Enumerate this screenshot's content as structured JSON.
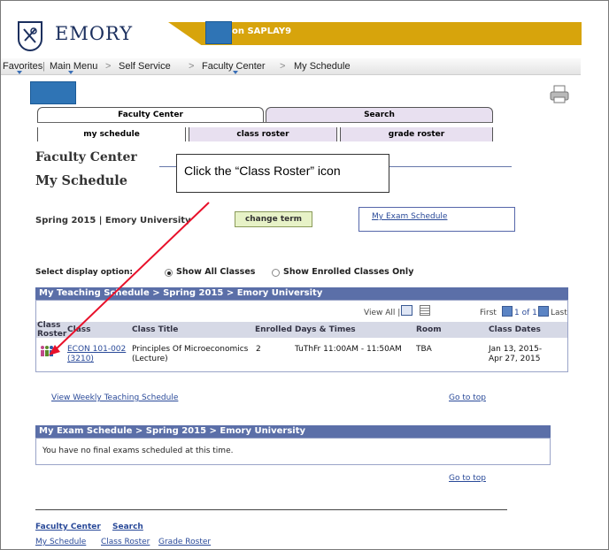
{
  "header": {
    "logo_text": "EMORY",
    "environment": "on SAPLAY9",
    "colors": {
      "navy": "#1b2f5e",
      "gold": "#d7a40c",
      "redaction_blue": "#2f74b5"
    }
  },
  "menu": {
    "favorites": "Favorites",
    "main_menu": "Main Menu",
    "sep": ">",
    "self_service": "Self Service",
    "faculty_center": "Faculty Center",
    "my_schedule": "My Schedule"
  },
  "tabs": {
    "faculty_center": "Faculty Center",
    "search": "Search"
  },
  "subtabs": {
    "my_schedule": "my schedule",
    "class_roster": "class roster",
    "grade_roster": "grade roster"
  },
  "page": {
    "section_title": "Faculty Center",
    "page_title": "My Schedule",
    "term": "Spring 2015 | Emory University",
    "change_term": "change term",
    "exam_schedule_link": "My Exam Schedule"
  },
  "callout": {
    "text": "Click the “Class Roster” icon"
  },
  "display_options": {
    "label": "Select display option:",
    "all_classes": "Show All Classes",
    "enrolled_only": "Show Enrolled Classes Only",
    "selected": "all"
  },
  "teaching_grid": {
    "title": "My Teaching Schedule > Spring 2015 > Emory University",
    "view_all": "View All |",
    "first": "First",
    "pagination": "1 of 1",
    "last": "Last",
    "columns": [
      "Class Roster",
      "Class",
      "Class Title",
      "Enrolled",
      "Days & Times",
      "Room",
      "Class Dates"
    ],
    "rows": [
      {
        "class_line1": "ECON 101-002",
        "class_line2": "(3210)",
        "title_line1": "Principles Of Microeconomics",
        "title_line2": "(Lecture)",
        "enrolled": "2",
        "days_times": "TuThFr 11:00AM - 11:50AM",
        "room": "TBA",
        "dates_line1": "Jan 13, 2015-",
        "dates_line2": "Apr 27, 2015"
      }
    ]
  },
  "links": {
    "weekly_schedule": "View Weekly Teaching Schedule",
    "go_to_top": "Go to top"
  },
  "exam_grid": {
    "title": "My Exam Schedule > Spring 2015 > Emory University",
    "message": "You have no final exams scheduled at this time."
  },
  "footer": {
    "faculty_center": "Faculty Center",
    "search": "Search",
    "my_schedule": "My Schedule",
    "class_roster": "Class Roster",
    "grade_roster": "Grade Roster"
  }
}
